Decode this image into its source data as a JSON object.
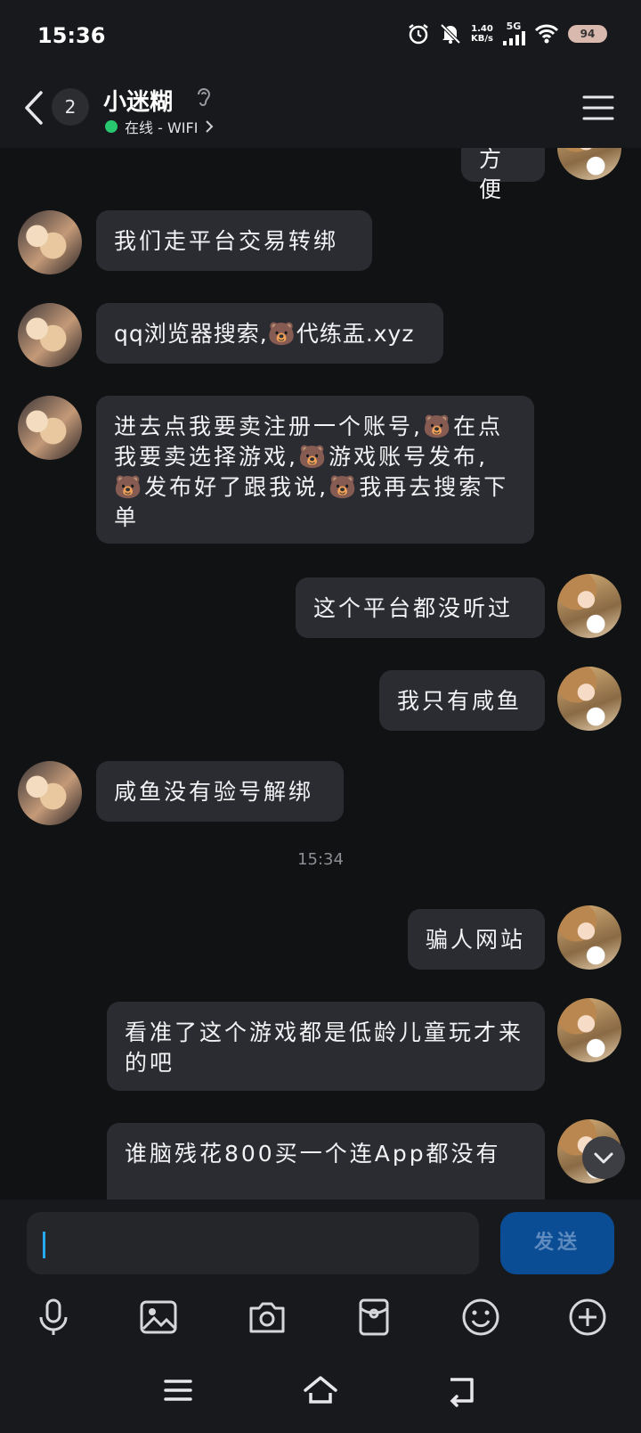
{
  "status_bar": {
    "time": "15:36",
    "speed_value": "1.40",
    "speed_unit": "KB/s",
    "network": "5G",
    "battery": "94"
  },
  "header": {
    "back_count": "2",
    "name": "小迷糊",
    "presence": "在线 - WIFI"
  },
  "chat": {
    "partial_top": "方便",
    "messages": [
      {
        "side": "in",
        "text": "我们走平台交易转绑"
      },
      {
        "side": "in",
        "text": "qq浏览器搜索,🐻代练盂.xyz"
      },
      {
        "side": "in",
        "text": "进去点我要卖注册一个账号,🐻在点我要卖选择游戏,🐻游戏账号发布,🐻发布好了跟我说,🐻我再去搜索下单"
      },
      {
        "side": "out",
        "text": "这个平台都没听过"
      },
      {
        "side": "out",
        "text": "我只有咸鱼"
      },
      {
        "side": "in",
        "text": "咸鱼没有验号解绑"
      },
      {
        "side": "out",
        "text": "骗人网站"
      },
      {
        "side": "out",
        "text": "看准了这个游戏都是低龄儿童玩才来的吧"
      },
      {
        "side": "out",
        "text": "谁脑残花800买一个连App都没有"
      }
    ],
    "timestamp": "15:34"
  },
  "composer": {
    "input_value": "",
    "send_label": "发送"
  },
  "toolbar": {
    "icons": [
      "microphone-icon",
      "image-icon",
      "camera-icon",
      "red-packet-icon",
      "emoji-icon",
      "plus-icon"
    ]
  },
  "nav_bar": {
    "icons": [
      "menu-icon",
      "home-icon",
      "back-icon"
    ]
  },
  "colors": {
    "background": "#111214",
    "bubble": "#2b2c31",
    "online": "#28c76f",
    "send_button": "#0b4d94"
  }
}
